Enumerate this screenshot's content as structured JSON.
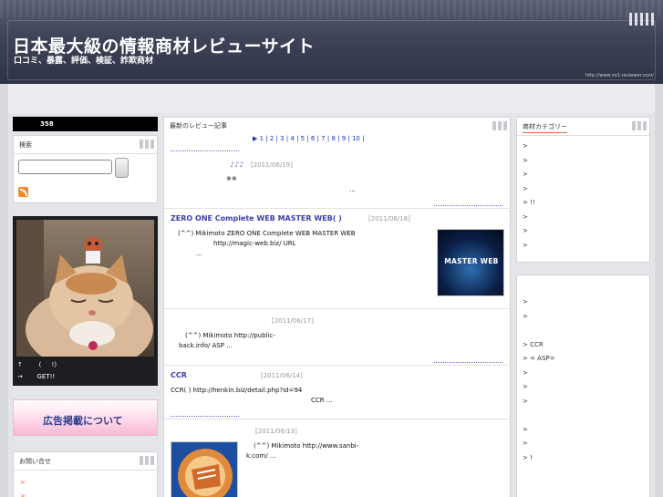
{
  "header": {
    "title": "日本最大級の情報商材レビューサイト",
    "subtitle": "口コミ、暴露、評価、検証、詐欺商材",
    "url": "http://www.no1-reviewer.com/"
  },
  "left": {
    "counter": "358",
    "search_title": "検索",
    "profile_line1": "↑        (     !)",
    "profile_line2": "→       GET!!",
    "ad_banner": "広告掲載について",
    "contact_title": "お問い合せ",
    "contact_items": [
      ">",
      ">"
    ]
  },
  "center": {
    "title": "最新のレビュー記事",
    "pager": "▶ 1 | 2 | 3 | 4 | 5 | 6 | 7 | 8 | 9 | 10 |",
    "entries": [
      {
        "title": "♪♪♪",
        "date": "[2011/06/19]",
        "line1": "※※",
        "line2": "..."
      },
      {
        "title": "ZERO ONE Complete WEB  MASTER WEB(       )",
        "date": "[2011/06/18]",
        "line1": "(^^)               Mikimoto                     ZERO ONE Complete WEB MASTER WEB",
        "line2": "http://magic-web.biz/ URL",
        "line3": "...",
        "thumb": "MASTER WEB"
      },
      {
        "title": "",
        "date": "[2011/06/17]",
        "line1": "(^^)          Mikimoto                                                                  http://public-",
        "line2": "back.info/                                              ASP                                         ..."
      },
      {
        "title": "CCR",
        "date": "[2011/06/14]",
        "line1": "CCR(              )                                        http://henkin.biz/detail.php?id=94",
        "line2": "CCR                                ..."
      },
      {
        "title": "",
        "date": "[2011/06/13]",
        "line1": "(^^)              Mikimoto                                    http://www.sanbi-",
        "line2": "k.com/                                                                                          ..."
      }
    ]
  },
  "right": {
    "category_title": "商材カテゴリー",
    "categories": [
      ">",
      ">",
      ">",
      ">",
      ">   !!",
      ">",
      ">",
      ">"
    ],
    "list2": [
      ">",
      ">",
      "",
      "> CCR",
      ">       =  ASP=",
      ">",
      ">",
      ">",
      "",
      ">",
      ">",
      ">             !"
    ]
  },
  "colors": {
    "accent": "#e0663b",
    "link": "#3b3fae",
    "header_bg": "#3e4358"
  }
}
